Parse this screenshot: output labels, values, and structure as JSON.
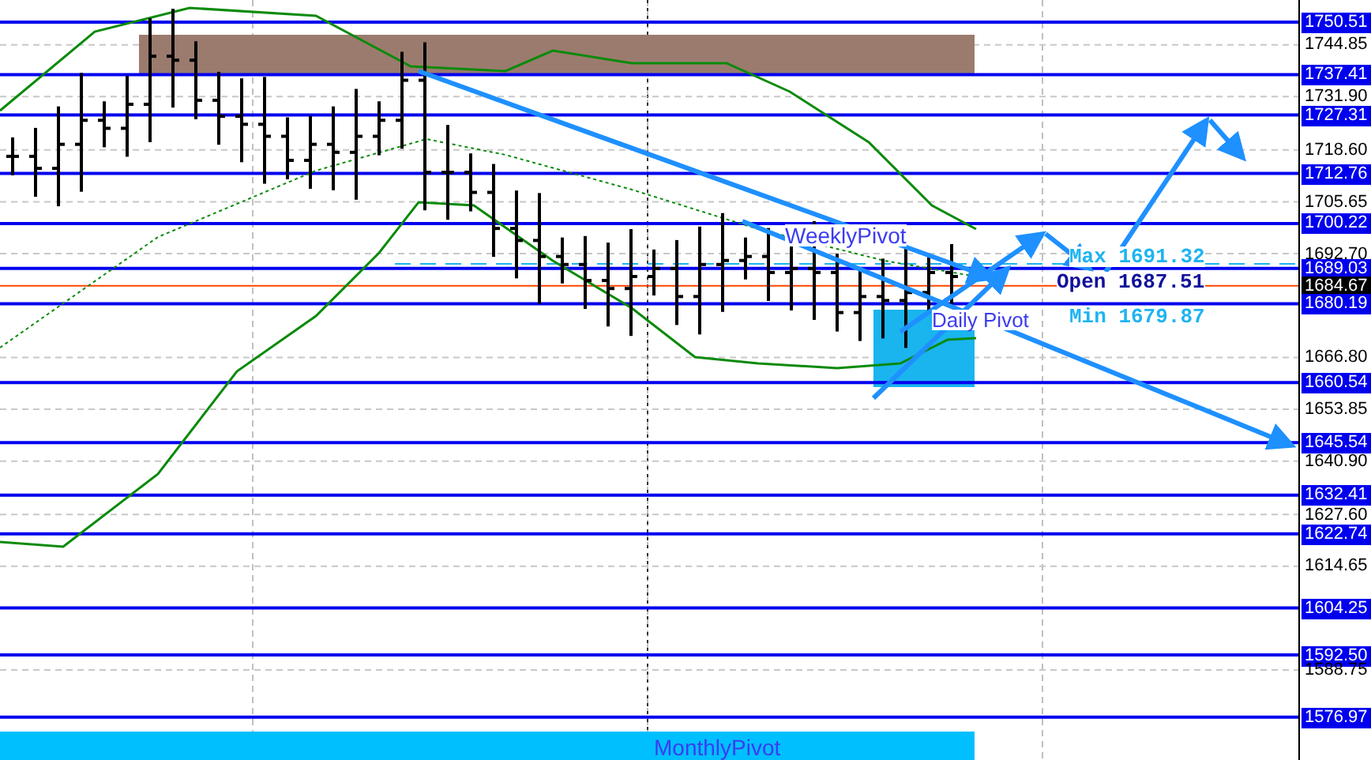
{
  "price_axis": [
    {
      "text": "1750.51",
      "kind": "level"
    },
    {
      "text": "1744.85",
      "kind": "tick"
    },
    {
      "text": "1737.41",
      "kind": "level"
    },
    {
      "text": "1731.90",
      "kind": "tick"
    },
    {
      "text": "1727.31",
      "kind": "level"
    },
    {
      "text": "1718.60",
      "kind": "tick"
    },
    {
      "text": "1712.76",
      "kind": "level"
    },
    {
      "text": "1705.65",
      "kind": "tick"
    },
    {
      "text": "1700.22",
      "kind": "level"
    },
    {
      "text": "1692.70",
      "kind": "tick"
    },
    {
      "text": "1689.03",
      "kind": "level"
    },
    {
      "text": "1684.67",
      "kind": "current"
    },
    {
      "text": "1680.19",
      "kind": "level"
    },
    {
      "text": "1666.80",
      "kind": "tick"
    },
    {
      "text": "1660.54",
      "kind": "level"
    },
    {
      "text": "1653.85",
      "kind": "tick"
    },
    {
      "text": "1645.54",
      "kind": "level"
    },
    {
      "text": "1640.90",
      "kind": "tick"
    },
    {
      "text": "1632.41",
      "kind": "level"
    },
    {
      "text": "1627.60",
      "kind": "tick"
    },
    {
      "text": "1622.74",
      "kind": "level"
    },
    {
      "text": "1614.65",
      "kind": "tick"
    },
    {
      "text": "1604.25",
      "kind": "level"
    },
    {
      "text": "1592.50",
      "kind": "level"
    },
    {
      "text": "1588.75",
      "kind": "tick"
    },
    {
      "text": "1576.97",
      "kind": "level"
    }
  ],
  "annotations": [
    {
      "text": "WeeklyPivot",
      "color": "#3c3cf0"
    },
    {
      "text": "Daily Pivot",
      "color": "#3c3cf0"
    },
    {
      "text": "MonthlyPivot",
      "color": "#3c3cf0"
    },
    {
      "text": "Max 1691.32",
      "color": "#1fb4f0"
    },
    {
      "text": "Open 1687.51",
      "color": "#10109a"
    },
    {
      "text": "Min 1679.87",
      "color": "#1fb4f0"
    }
  ]
}
